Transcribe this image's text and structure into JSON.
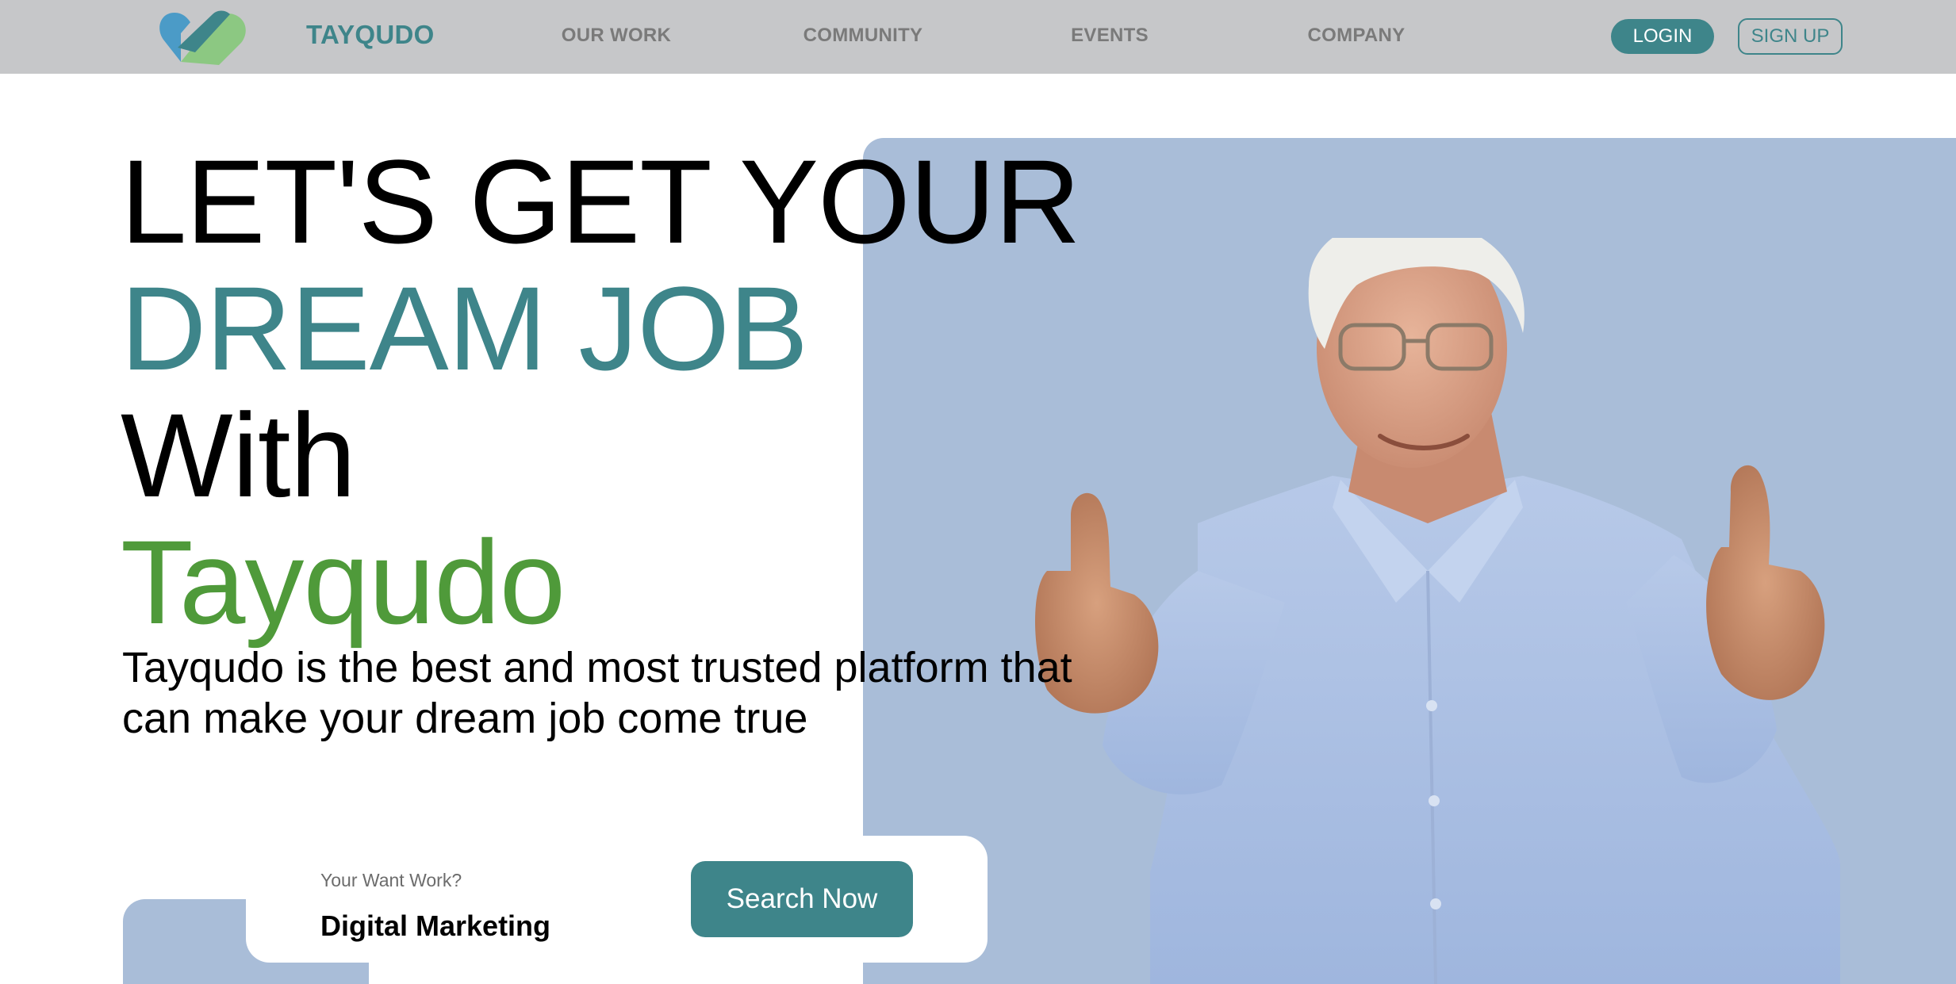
{
  "brand": {
    "name": "TAYQUDO",
    "logo_icon": "heart-ribbon-logo"
  },
  "nav": {
    "links": [
      "OUR WORK",
      "COMMUNITY",
      "EVENTS",
      "COMPANY"
    ],
    "login_label": "LOGIN",
    "signup_label": "SIGN UP"
  },
  "hero": {
    "line1": "LET'S GET YOUR",
    "line2": "DREAM JOB",
    "line3": "With",
    "line4": "Tayqudo",
    "subtitle": "Tayqudo is the best and most trusted platform that can make your dream job come true"
  },
  "search": {
    "label": "Your Want Work?",
    "value": "Digital Marketing",
    "button_label": "Search Now"
  },
  "colors": {
    "accent_teal": "#3e858a",
    "accent_green": "#4f9a3a",
    "navbar_bg": "#c6c7c9",
    "panel_blue": "#a9bdd8"
  }
}
